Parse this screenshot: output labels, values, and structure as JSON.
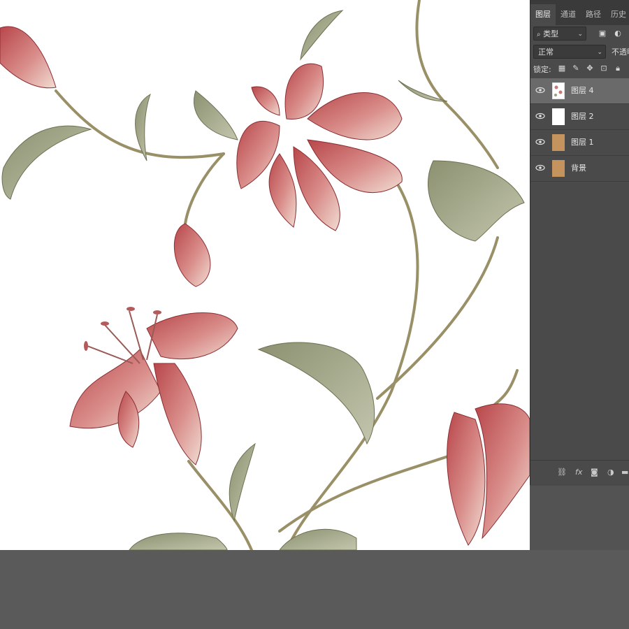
{
  "panel": {
    "tabs": [
      {
        "label": "图层",
        "active": true
      },
      {
        "label": "通道"
      },
      {
        "label": "路径"
      },
      {
        "label": "历史"
      }
    ],
    "filter": {
      "label": "类型"
    },
    "blend_mode": "正常",
    "opacity_label": "不透明",
    "lock_label": "锁定:",
    "layers": [
      {
        "name": "图层 4",
        "thumb": "pattern",
        "selected": true
      },
      {
        "name": "图层 2",
        "thumb": "white"
      },
      {
        "name": "图层 1",
        "thumb": "tan"
      },
      {
        "name": "背景",
        "thumb": "tan"
      }
    ],
    "footer": {
      "fx_label": "fx"
    }
  },
  "colors": {
    "panel_bg": "#4a4a4a",
    "tab_bar": "#3a3a3a",
    "selected_layer": "#6a6a6a",
    "workspace": "#5a5a5a",
    "canvas": "#ffffff"
  }
}
